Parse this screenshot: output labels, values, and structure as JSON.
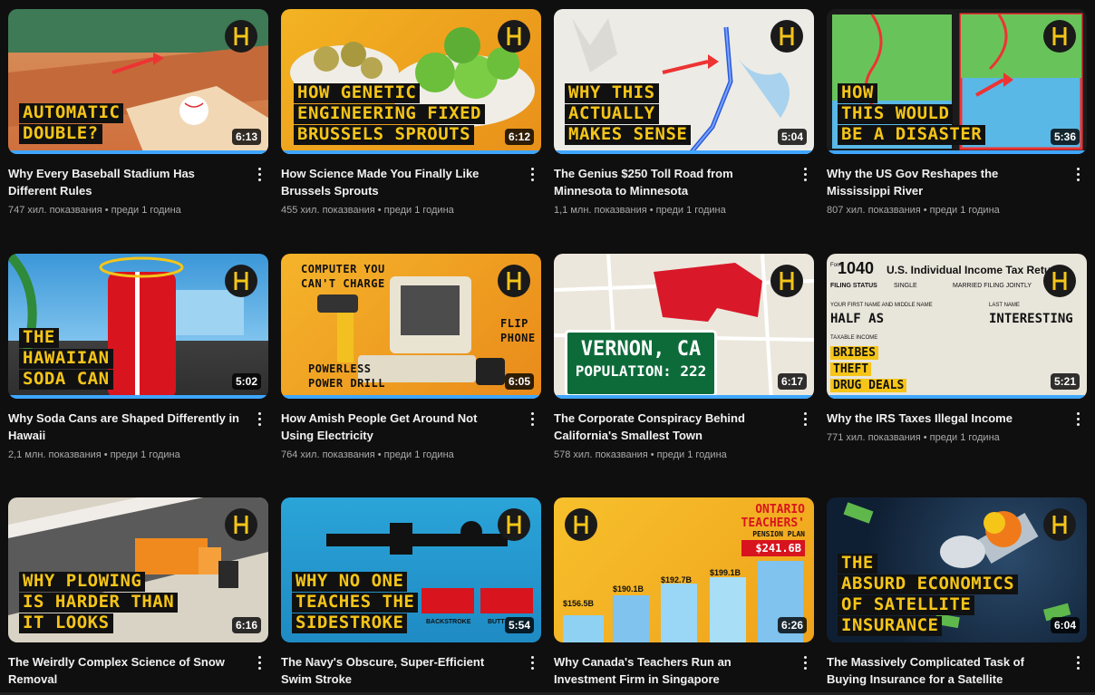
{
  "videos": [
    {
      "title": "Why Every Baseball Stadium Has Different Rules",
      "views": "747 хил. показвания",
      "age": "преди 1 година",
      "duration": "6:13",
      "overlay": [
        "AUTOMATIC",
        "DOUBLE?"
      ],
      "accent": "#d9673a"
    },
    {
      "title": "How Science Made You Finally Like Brussels Sprouts",
      "views": "455 хил. показвания",
      "age": "преди 1 година",
      "duration": "6:12",
      "overlay": [
        "HOW GENETIC",
        "ENGINEERING FIXED",
        "BRUSSELS SPROUTS"
      ],
      "accent": "#f2a31a"
    },
    {
      "title": "The Genius $250 Toll Road from Minnesota to Minnesota",
      "views": "1,1 млн. показвания",
      "age": "преди 1 година",
      "duration": "5:04",
      "overlay": [
        "WHY THIS",
        "ACTUALLY",
        "MAKES SENSE"
      ],
      "accent": "#e8e6e0"
    },
    {
      "title": "Why the US Gov Reshapes the Mississippi River",
      "views": "807 хил. показвания",
      "age": "преди 1 година",
      "duration": "5:36",
      "overlay": [
        "HOW",
        "THIS WOULD",
        "BE A DISASTER"
      ],
      "accent": "#4fb8e8"
    },
    {
      "title": "Why Soda Cans are Shaped Differently in Hawaii",
      "views": "2,1 млн. показвания",
      "age": "преди 1 година",
      "duration": "5:02",
      "overlay": [
        "THE",
        "HAWAIIAN",
        "SODA CAN"
      ],
      "accent": "#3b8fd6"
    },
    {
      "title": "How Amish People Get Around Not Using Electricity",
      "views": "764 хил. показвания",
      "age": "преди 1 година",
      "duration": "6:05",
      "overlay": [
        "COMPUTER YOU",
        "CAN'T CHARGE",
        "POWERLESS",
        "POWER DRILL",
        "FLIP",
        "PHONE"
      ],
      "accent": "#f3a41c"
    },
    {
      "title": "The Corporate Conspiracy Behind California's Smallest Town",
      "views": "578 хил. показвания",
      "age": "преди 1 година",
      "duration": "6:17",
      "overlay": [
        "VERNON, CA",
        "POPULATION: 222"
      ],
      "accent": "#e9e4da"
    },
    {
      "title": "Why the IRS Taxes Illegal Income",
      "views": "771 хил. показвания",
      "age": "преди 1 година",
      "duration": "5:21",
      "overlay": [
        "1040",
        "U.S. Individual Income Tax Return",
        "FILING STATUS",
        "SINGLE",
        "MARRIED FILING JOINTLY",
        "YOUR FIRST NAME AND MIDDLE NAME",
        "LAST NAME",
        "HALF AS",
        "INTERESTING",
        "TAXABLE INCOME",
        "BRIBES",
        "THEFT",
        "DRUG DEALS",
        "Form"
      ],
      "accent": "#e9e6dc"
    },
    {
      "title": "The Weirdly Complex Science of Snow Removal",
      "views": "",
      "age": "",
      "duration": "6:16",
      "overlay": [
        "WHY PLOWING",
        "IS HARDER THAN",
        "IT LOOKS"
      ],
      "accent": "#cfc8bc"
    },
    {
      "title": "The Navy's Obscure, Super-Efficient Swim Stroke",
      "views": "",
      "age": "",
      "duration": "5:54",
      "overlay": [
        "WHY NO ONE",
        "TEACHES THE",
        "SIDESTROKE",
        "BACKSTROKE",
        "BUTT"
      ],
      "accent": "#2bb3e0"
    },
    {
      "title": "Why Canada's Teachers Run an Investment Firm in Singapore",
      "views": "",
      "age": "",
      "duration": "6:26",
      "overlay": [
        "ONTARIO",
        "TEACHERS'",
        "PENSION PLAN",
        "$241.6B",
        "$156.5B",
        "$190.1B",
        "$192.7B",
        "$199.1B"
      ],
      "accent": "#f5b51e"
    },
    {
      "title": "The Massively Complicated Task of Buying Insurance for a Satellite",
      "views": "",
      "age": "",
      "duration": "6:04",
      "overlay": [
        "THE",
        "ABSURD ECONOMICS",
        "OF SATELLITE",
        "INSURANCE"
      ],
      "accent": "#1f3b56"
    }
  ]
}
